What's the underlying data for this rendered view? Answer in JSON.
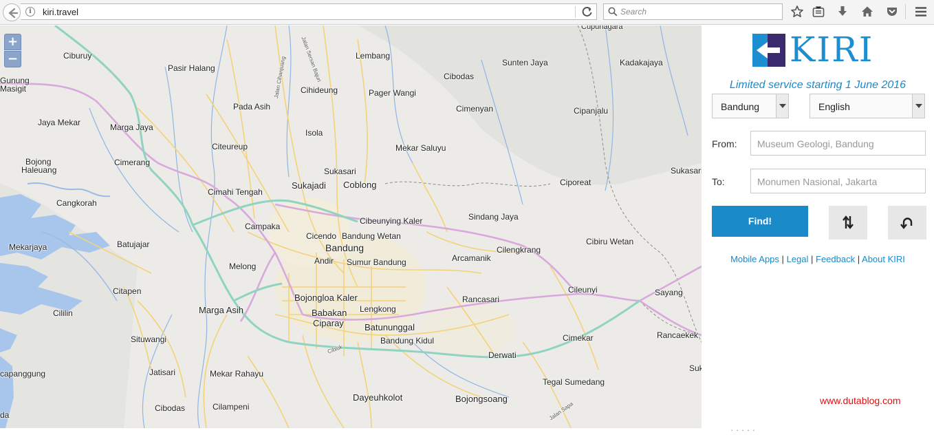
{
  "browser": {
    "url": "kiri.travel",
    "search_placeholder": "Search"
  },
  "map": {
    "zoom_in": "+",
    "zoom_out": "−",
    "places": [
      {
        "name": "Cupunagara"
      },
      {
        "name": "Ciburuy"
      },
      {
        "name": "Lembang"
      },
      {
        "name": "Sunten Jaya"
      },
      {
        "name": "Kadakajaya"
      },
      {
        "name": "Pasir Halang"
      },
      {
        "name": "Cibodas"
      },
      {
        "name": "Gunung"
      },
      {
        "name": "Masigit"
      },
      {
        "name": "Cihideung"
      },
      {
        "name": "Pager Wangi"
      },
      {
        "name": "Pada Asih"
      },
      {
        "name": "Cimenyan"
      },
      {
        "name": "Cipanjalu"
      },
      {
        "name": "Jaya Mekar"
      },
      {
        "name": "Marga Jaya"
      },
      {
        "name": "Isola"
      },
      {
        "name": "Citeureup"
      },
      {
        "name": "Mekar Saluyu"
      },
      {
        "name": "Bojong"
      },
      {
        "name": "Haleuang"
      },
      {
        "name": "Cimerang"
      },
      {
        "name": "Sukasari"
      },
      {
        "name": "Sukasari"
      },
      {
        "name": "Sukajadi"
      },
      {
        "name": "Coblong"
      },
      {
        "name": "Ciporeat"
      },
      {
        "name": "Cimahi Tengah"
      },
      {
        "name": "Cangkorah"
      },
      {
        "name": "Sindang Jaya"
      },
      {
        "name": "Campaka"
      },
      {
        "name": "Cibeunying Kaler"
      },
      {
        "name": "Cicendo"
      },
      {
        "name": "Bandung Wetan"
      },
      {
        "name": "Mekarjaya"
      },
      {
        "name": "Batujajar"
      },
      {
        "name": "Bandung"
      },
      {
        "name": "Cilengkrang"
      },
      {
        "name": "Cibiru Wetan"
      },
      {
        "name": "Andir"
      },
      {
        "name": "Sumur Bandung"
      },
      {
        "name": "Arcamanik"
      },
      {
        "name": "Melong"
      },
      {
        "name": "Citapen"
      },
      {
        "name": "Cileunyi"
      },
      {
        "name": "Sayang"
      },
      {
        "name": "Bojongloa Kaler"
      },
      {
        "name": "Rancasari"
      },
      {
        "name": "Lengkong"
      },
      {
        "name": "Marga Asih"
      },
      {
        "name": "Cililin"
      },
      {
        "name": "Babakan"
      },
      {
        "name": "Ciparay"
      },
      {
        "name": "Batununggal"
      },
      {
        "name": "Rancaekek"
      },
      {
        "name": "Cimekar"
      },
      {
        "name": "Situwangi"
      },
      {
        "name": "Bandung Kidul"
      },
      {
        "name": "Derwati"
      },
      {
        "name": "Jatisari"
      },
      {
        "name": "Mekar Rahayu"
      },
      {
        "name": "capanggung"
      },
      {
        "name": "Tegal Sumedang"
      },
      {
        "name": "Suk"
      },
      {
        "name": "Dayeuhkolot"
      },
      {
        "name": "Bojongsoang"
      },
      {
        "name": "Cibodas"
      },
      {
        "name": "Cilampeni"
      },
      {
        "name": "da"
      }
    ],
    "road_labels": [
      {
        "name": "Jalan Cihanjuang"
      },
      {
        "name": "Jalan Sersan Bajuri"
      },
      {
        "name": "Cibiuk"
      },
      {
        "name": "Jalan Sapa"
      }
    ]
  },
  "panel": {
    "logo_text": "KIRI",
    "tagline": "Limited service starting 1 June 2016",
    "city_select": "Bandung",
    "language_select": "English",
    "from_label": "From:",
    "from_placeholder": "Museum Geologi, Bandung",
    "to_label": "To:",
    "to_placeholder": "Monumen Nasional, Jakarta",
    "find_button": "Find!",
    "links": [
      "Mobile Apps",
      "Legal",
      "Feedback",
      "About KIRI"
    ],
    "link_separator": "|",
    "watermark": "www.dutablog.com",
    "cutoff_text": "· · · · ·"
  },
  "colors": {
    "accent": "#1a8ac9",
    "logo_dark": "#3b2a6e",
    "toll_road": "#8fd3c0",
    "primary_road": "#d9a8dd",
    "minor_road": "#f3d27a",
    "water": "#a8c6ec"
  }
}
